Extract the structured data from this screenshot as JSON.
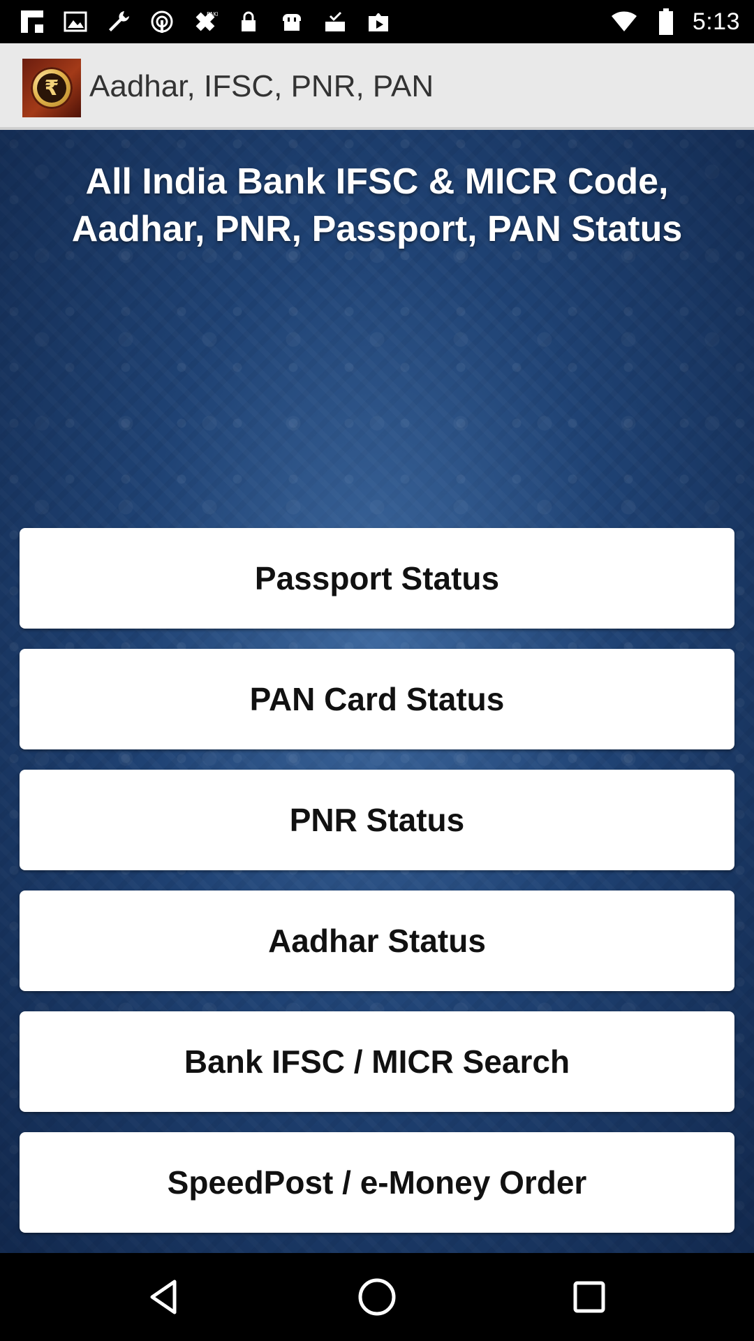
{
  "status_bar": {
    "time": "5:13",
    "left_icons": [
      "flipboard-icon",
      "image-icon",
      "wrench-icon",
      "hotspot-icon",
      "fake-gps-icon",
      "lock-icon",
      "toast-icon",
      "inbox-icon",
      "play-store-icon"
    ],
    "right_icons": [
      "wifi-icon",
      "battery-icon"
    ]
  },
  "action_bar": {
    "title": "Aadhar, IFSC, PNR, PAN",
    "app_icon_symbol": "₹"
  },
  "main": {
    "headline": "All India Bank IFSC & MICR Code, Aadhar, PNR, Passport, PAN Status",
    "buttons": [
      {
        "label": "Passport Status"
      },
      {
        "label": "PAN Card Status"
      },
      {
        "label": "PNR Status"
      },
      {
        "label": "Aadhar Status"
      },
      {
        "label": "Bank IFSC / MICR Search"
      },
      {
        "label": "SpeedPost / e-Money Order"
      }
    ]
  },
  "nav_bar": {
    "buttons": [
      "back-icon",
      "home-icon",
      "recents-icon"
    ]
  }
}
